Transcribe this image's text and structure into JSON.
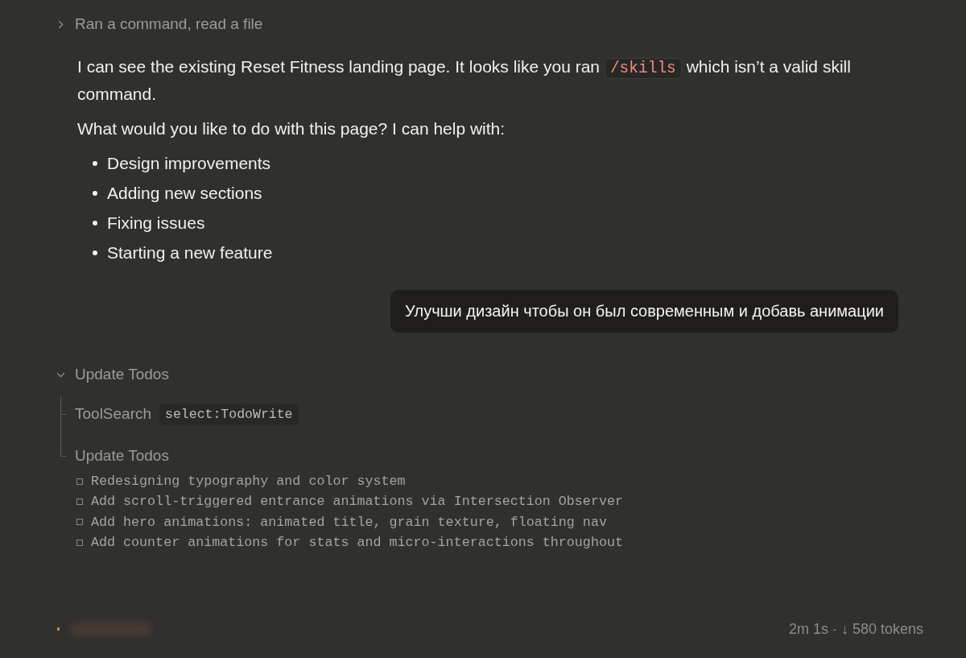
{
  "collapsed_step": {
    "label": "Ran a command, read a file",
    "expanded": false
  },
  "assistant_message": {
    "paragraphs": [
      {
        "parts": [
          {
            "kind": "text",
            "text": "I can see the existing Reset Fitness landing page. It looks like you ran"
          },
          {
            "kind": "code",
            "text": "/skills"
          },
          {
            "kind": "text",
            "text": "which isn’t a valid skill command."
          }
        ]
      },
      {
        "parts": [
          {
            "kind": "text",
            "text": "What would you like to do with this page? I can help with:"
          }
        ]
      }
    ],
    "bullets": [
      "Design improvements",
      "Adding new sections",
      "Fixing issues",
      "Starting a new feature"
    ]
  },
  "user_message": {
    "text": "Улучши дизайн чтобы он был современным и добавь анимации"
  },
  "todo_step": {
    "label": "Update Todos",
    "expanded": true,
    "children": [
      {
        "name": "ToolSearch",
        "argument": "select:TodoWrite"
      },
      {
        "name": "Update Todos"
      }
    ],
    "todos": [
      {
        "text": "Redesigning typography and color system",
        "checked": false
      },
      {
        "text": "Add scroll-triggered entrance animations via Intersection Observer",
        "checked": false
      },
      {
        "text": "Add hero animations: animated title, grain texture, floating nav",
        "checked": false
      },
      {
        "text": "Add counter animations for stats and micro-interactions throughout",
        "checked": false
      }
    ]
  },
  "status_bar": {
    "stats": "2m 1s · ↓ 580 tokens"
  }
}
